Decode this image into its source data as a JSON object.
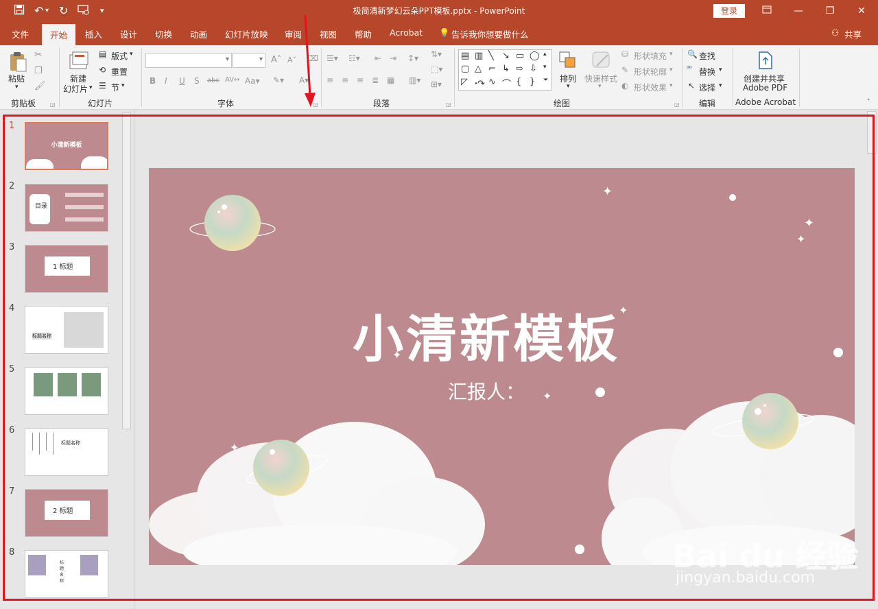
{
  "window": {
    "title": "极简清新梦幻云朵PPT模板.pptx  -  PowerPoint",
    "login_label": "登录",
    "share_label": "共享"
  },
  "tabs": [
    {
      "label": "文件",
      "active": false
    },
    {
      "label": "开始",
      "active": true
    },
    {
      "label": "插入",
      "active": false
    },
    {
      "label": "设计",
      "active": false
    },
    {
      "label": "切换",
      "active": false
    },
    {
      "label": "动画",
      "active": false
    },
    {
      "label": "幻灯片放映",
      "active": false
    },
    {
      "label": "审阅",
      "active": false
    },
    {
      "label": "视图",
      "active": false
    },
    {
      "label": "帮助",
      "active": false
    },
    {
      "label": "Acrobat",
      "active": false
    }
  ],
  "tell_me": "告诉我你想要做什么",
  "ribbon": {
    "clipboard": {
      "paste": "粘贴",
      "label": "剪贴板"
    },
    "slides": {
      "new_slide_line1": "新建",
      "new_slide_line2": "幻灯片",
      "layout": "版式",
      "reset": "重置",
      "section": "节",
      "label": "幻灯片"
    },
    "font": {
      "label": "字体"
    },
    "paragraph": {
      "label": "段落"
    },
    "drawing": {
      "arrange": "排列",
      "quick_styles": "快速样式",
      "shape_fill": "形状填充",
      "shape_outline": "形状轮廓",
      "shape_effects": "形状效果",
      "label": "绘图"
    },
    "editing": {
      "find": "查找",
      "replace": "替换",
      "select": "选择",
      "label": "编辑"
    },
    "acrobat": {
      "create_line1": "创建并共享",
      "create_line2": "Adobe PDF",
      "label": "Adobe Acrobat"
    }
  },
  "thumbnails": [
    {
      "num": "1",
      "text": "小清新模板",
      "active": true
    },
    {
      "num": "2",
      "text": "目录",
      "active": false
    },
    {
      "num": "3",
      "text": "1 标题",
      "active": false
    },
    {
      "num": "4",
      "text": "标题名称",
      "active": false
    },
    {
      "num": "5",
      "text": "",
      "active": false
    },
    {
      "num": "6",
      "text": "标题名称",
      "active": false
    },
    {
      "num": "7",
      "text": "2 标题",
      "active": false
    },
    {
      "num": "8",
      "text": "标题名称",
      "active": false
    }
  ],
  "slide": {
    "title": "小清新模板",
    "subtitle": "汇报人：",
    "background": "#bd8b8f"
  },
  "watermark": {
    "logo": "Bai du 经验",
    "url": "jingyan.baidu.com"
  },
  "colors": {
    "accent": "#b7472a",
    "annotation": "#e3141e"
  }
}
